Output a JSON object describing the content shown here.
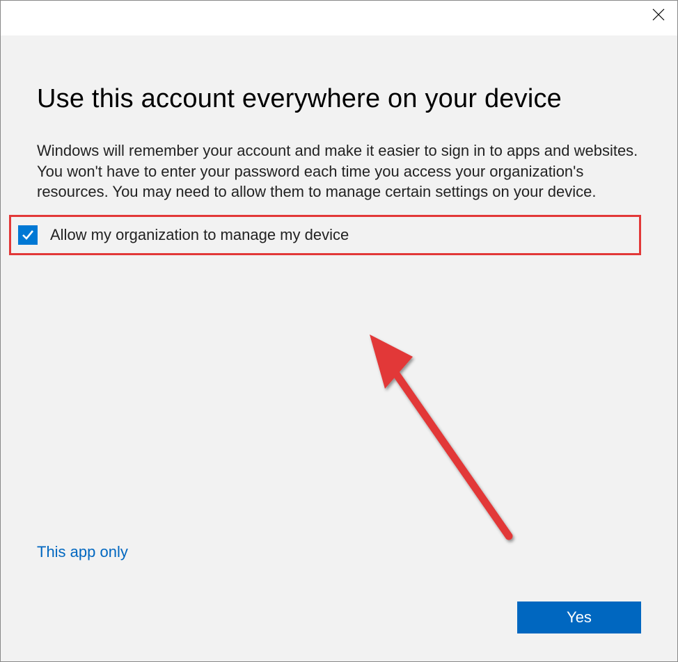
{
  "dialog": {
    "title": "Use this account everywhere on your device",
    "description": "Windows will remember your account and make it easier to sign in to apps and websites. You won't have to enter your password each time you access your organization's resources. You may need to allow them to manage certain settings on your device.",
    "checkbox_label": "Allow my organization to manage my device",
    "link_label": "This app only",
    "primary_button": "Yes"
  },
  "colors": {
    "accent": "#0067c0",
    "checkbox_fill": "#0078d4",
    "highlight": "#e23838",
    "body_bg": "#f2f2f2"
  }
}
